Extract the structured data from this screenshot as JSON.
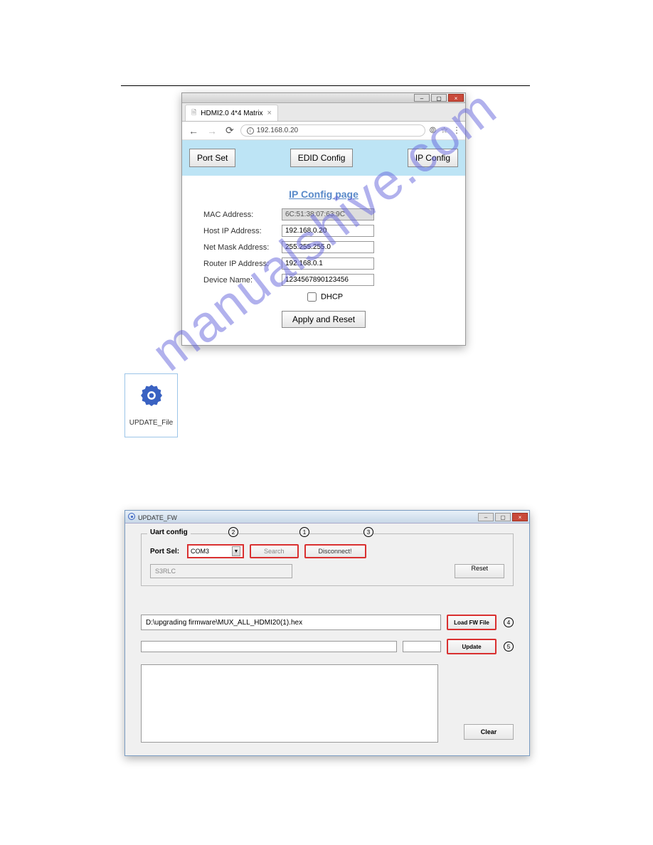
{
  "watermark": "manualshive.com",
  "browser": {
    "tab_title": "HDMI2.0 4*4 Matrix",
    "tab_close": "×",
    "url": "192.168.0.20",
    "toolbar": {
      "port_set": "Port Set",
      "edid": "EDID Config",
      "ip": "IP Config"
    },
    "page": {
      "heading": "IP Config page",
      "mac_label": "MAC Address:",
      "mac_value": "6C:51:38:07:63:9C",
      "host_label": "Host IP Address:",
      "host_value": "192.168.0.20",
      "mask_label": "Net Mask Address:",
      "mask_value": "255.255.255.0",
      "router_label": "Router IP Address:",
      "router_value": "192.168.0.1",
      "device_label": "Device Name:",
      "device_value": "1234567890123456",
      "dhcp_label": "DHCP",
      "apply": "Apply and Reset"
    }
  },
  "desktop_icon": {
    "label": "UPDATE_File"
  },
  "fw": {
    "title": "UPDATE_FW",
    "uart_legend": "Uart config",
    "port_sel_label": "Port Sel:",
    "port_sel_value": "COM3",
    "search_btn": "Search",
    "disconnect_btn": "Disconnect!",
    "status": "S3RLC",
    "reset_btn": "Reset",
    "file_path": "D:\\upgrading firmware\\MUX_ALL_HDMI20(1).hex",
    "load_btn": "Load FW File",
    "update_btn": "Update",
    "clear_btn": "Clear",
    "callouts": {
      "c1": "1",
      "c2": "2",
      "c3": "3",
      "c4": "4",
      "c5": "5"
    }
  }
}
